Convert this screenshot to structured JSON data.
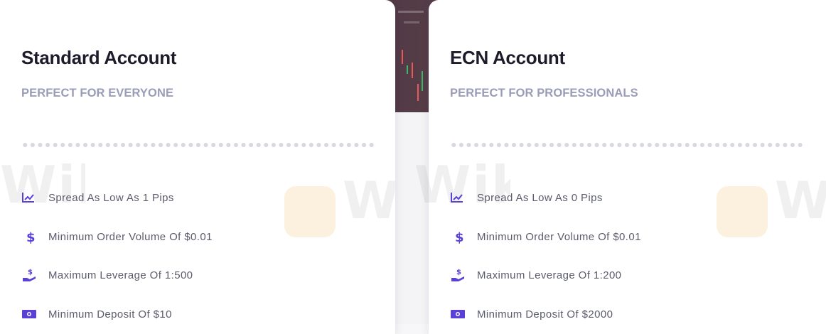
{
  "accounts": [
    {
      "title": "Standard Account",
      "subtitle": "PERFECT FOR EVERYONE",
      "features": [
        {
          "icon": "chart-line-icon",
          "text": "Spread As Low As 1 Pips"
        },
        {
          "icon": "dollar-icon",
          "text": "Minimum Order Volume Of $0.01"
        },
        {
          "icon": "hand-dollar-icon",
          "text": "Maximum Leverage Of 1:500"
        },
        {
          "icon": "banknote-icon",
          "text": "Minimum Deposit Of $10"
        }
      ]
    },
    {
      "title": "ECN Account",
      "subtitle": "PERFECT FOR PROFESSIONALS",
      "features": [
        {
          "icon": "chart-line-icon",
          "text": "Spread As Low As 0 Pips"
        },
        {
          "icon": "dollar-icon",
          "text": "Minimum Order Volume Of $0.01"
        },
        {
          "icon": "hand-dollar-icon",
          "text": "Maximum Leverage Of 1:200"
        },
        {
          "icon": "banknote-icon",
          "text": "Minimum Deposit Of $2000"
        }
      ]
    }
  ],
  "watermark": "WikiFX",
  "colors": {
    "accent": "#5a3fd9",
    "title": "#1d1c2b",
    "subtitle": "#9a9cb8",
    "text": "#5b5c6c"
  }
}
